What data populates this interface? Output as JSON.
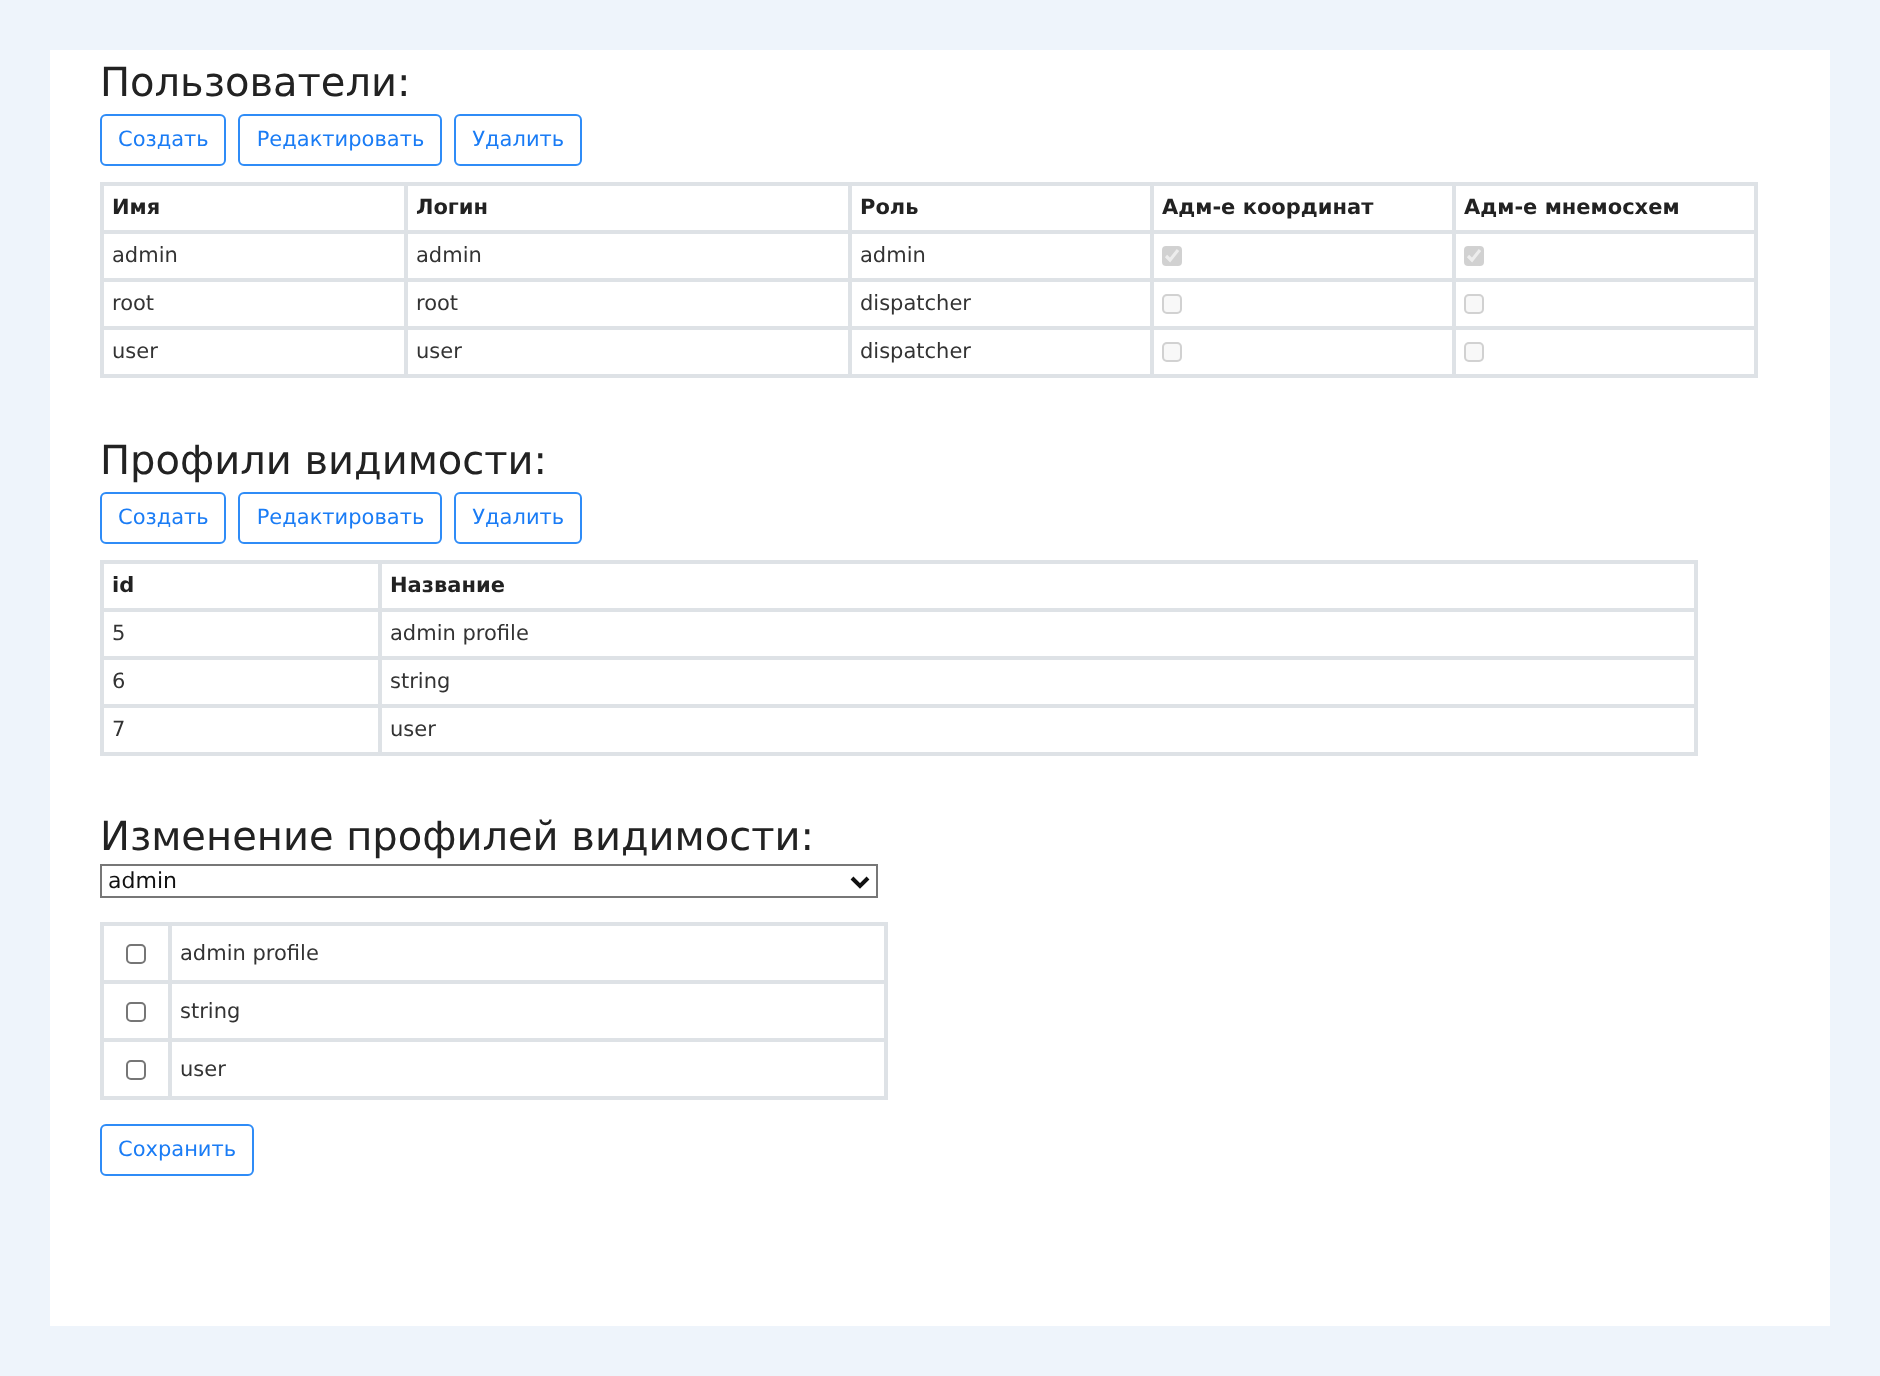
{
  "users": {
    "title": "Пользователи:",
    "buttons": [
      "Создать",
      "Редактировать",
      "Удалить"
    ],
    "columns": [
      "Имя",
      "Логин",
      "Роль",
      "Адм-е координат",
      "Адм-е мнемосхем"
    ],
    "rows": [
      {
        "name": "admin",
        "login": "admin",
        "role": "admin",
        "coord_admin": {
          "checked": true,
          "disabled": true
        },
        "mnemo_admin": {
          "checked": true,
          "disabled": true
        }
      },
      {
        "name": "root",
        "login": "root",
        "role": "dispatcher",
        "coord_admin": {
          "checked": false,
          "disabled": true
        },
        "mnemo_admin": {
          "checked": false,
          "disabled": true
        }
      },
      {
        "name": "user",
        "login": "user",
        "role": "dispatcher",
        "coord_admin": {
          "checked": false,
          "disabled": true
        },
        "mnemo_admin": {
          "checked": false,
          "disabled": true
        }
      }
    ]
  },
  "profiles": {
    "title": "Профили видимости:",
    "buttons": [
      "Создать",
      "Редактировать",
      "Удалить"
    ],
    "columns": [
      "id",
      "Название"
    ],
    "rows": [
      {
        "id": "5",
        "name": "admin profile"
      },
      {
        "id": "6",
        "name": "string"
      },
      {
        "id": "7",
        "name": "user"
      }
    ]
  },
  "edit": {
    "title": "Изменение профилей видимости:",
    "select_value": "admin",
    "items": [
      {
        "label": "admin profile",
        "checked": false
      },
      {
        "label": "string",
        "checked": false
      },
      {
        "label": "user",
        "checked": false
      }
    ],
    "save_button": "Сохранить"
  }
}
